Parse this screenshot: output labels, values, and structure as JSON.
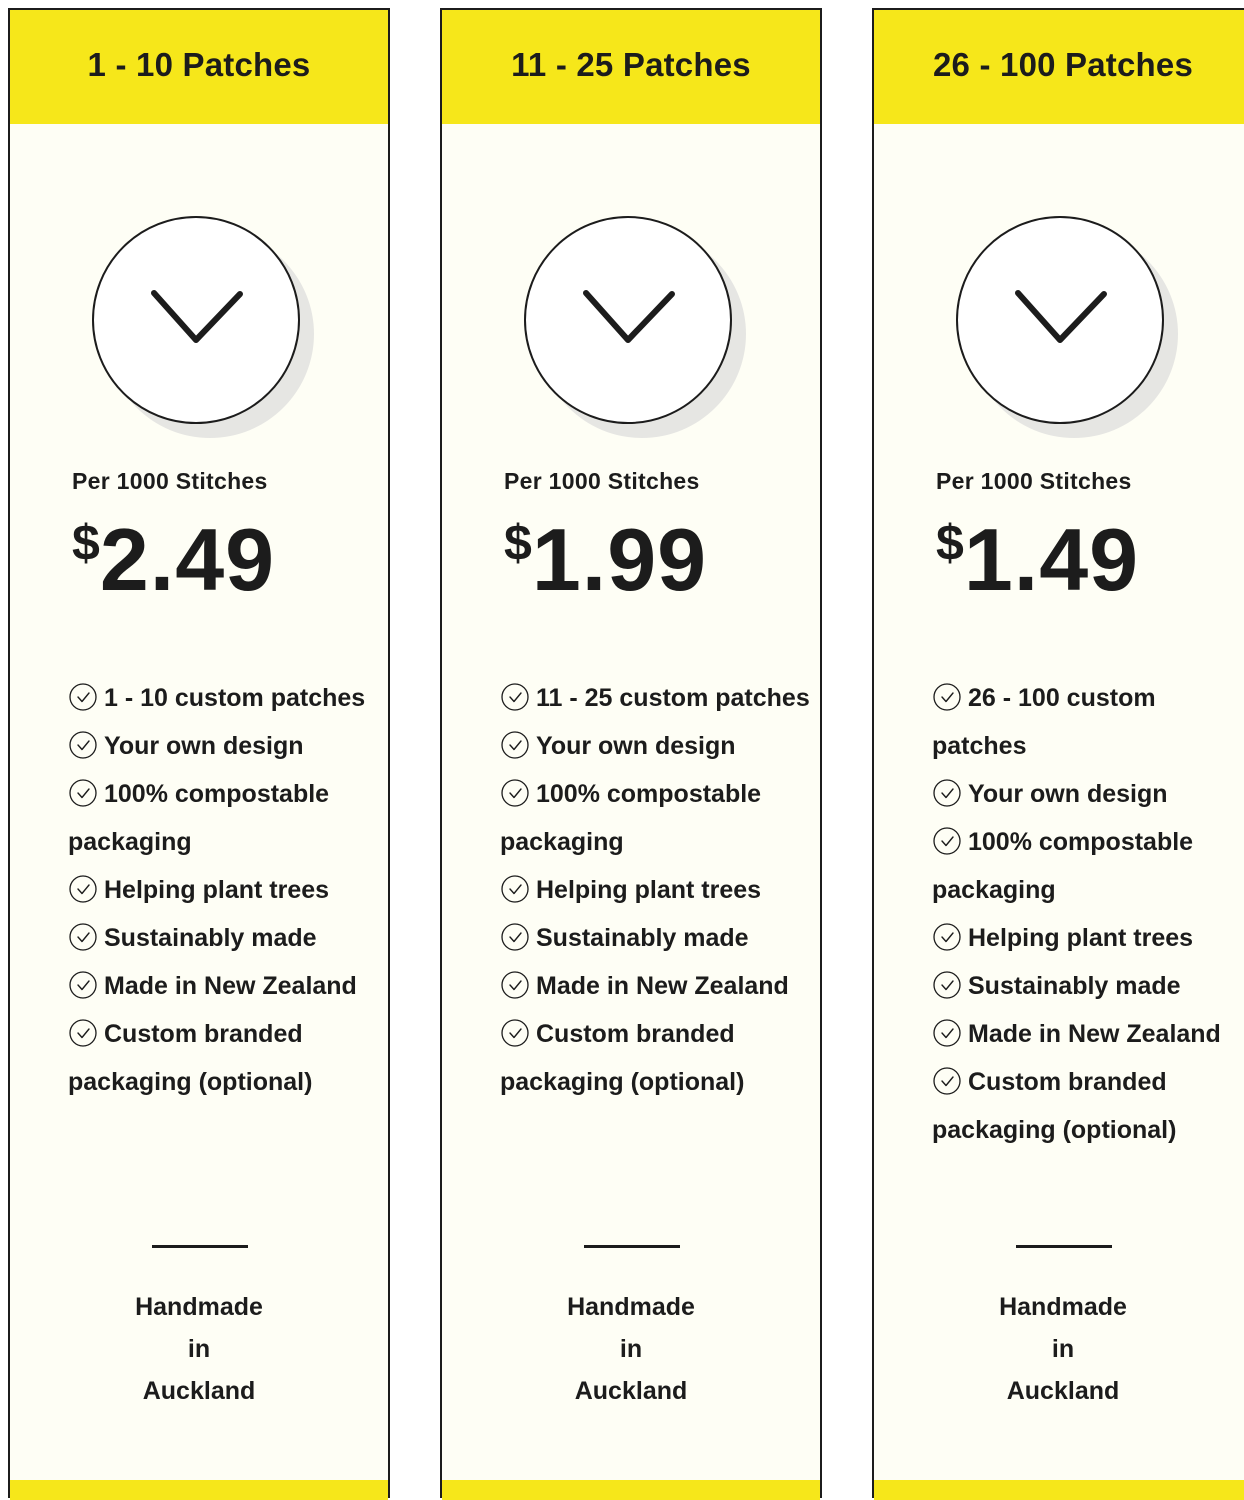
{
  "colors": {
    "accent_yellow": "#f6e71a",
    "card_background": "#fefef5",
    "ink": "#1c1c1c",
    "shadow": "#e6e6e3"
  },
  "cards": [
    {
      "title": "1 - 10 Patches",
      "icon": "checkmark-icon",
      "price_caption": "Per 1000 Stitches",
      "currency": "$",
      "price": "2.49",
      "features": [
        "1 - 10 custom patches",
        "Your own design",
        "100% compostable packaging",
        "Helping plant trees",
        "Sustainably made",
        "Made in New Zealand",
        "Custom branded packaging (optional)"
      ],
      "footer_lines": [
        "Handmade",
        "in",
        "Auckland"
      ]
    },
    {
      "title": "11 - 25 Patches",
      "icon": "checkmark-icon",
      "price_caption": "Per 1000 Stitches",
      "currency": "$",
      "price": "1.99",
      "features": [
        "11 - 25 custom patches",
        "Your own design",
        "100% compostable packaging",
        "Helping plant trees",
        "Sustainably made",
        "Made in New Zealand",
        "Custom branded packaging (optional)"
      ],
      "footer_lines": [
        "Handmade",
        "in",
        "Auckland"
      ]
    },
    {
      "title": "26 - 100 Patches",
      "icon": "checkmark-icon",
      "price_caption": "Per 1000 Stitches",
      "currency": "$",
      "price": "1.49",
      "features": [
        "26 - 100 custom patches",
        "Your own design",
        "100% compostable packaging",
        "Helping plant trees",
        "Sustainably made",
        "Made in New Zealand",
        "Custom branded packaging (optional)"
      ],
      "footer_lines": [
        "Handmade",
        "in",
        "Auckland"
      ]
    }
  ]
}
